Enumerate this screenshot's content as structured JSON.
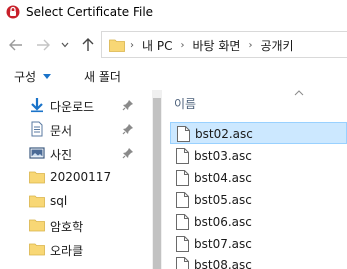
{
  "window": {
    "title": "Select Certificate File"
  },
  "address": {
    "crumbs": [
      "내 PC",
      "바탕 화면",
      "공개키"
    ]
  },
  "toolbar": {
    "organize": "구성",
    "new_folder": "새 폴더"
  },
  "sidebar": {
    "items": [
      {
        "label": "다운로드",
        "icon": "download-icon",
        "pinned": true
      },
      {
        "label": "문서",
        "icon": "documents-icon",
        "pinned": true
      },
      {
        "label": "사진",
        "icon": "pictures-icon",
        "pinned": true
      },
      {
        "label": "20200117",
        "icon": "folder-icon",
        "pinned": false
      },
      {
        "label": "sql",
        "icon": "folder-icon",
        "pinned": false
      },
      {
        "label": "암호학",
        "icon": "folder-icon",
        "pinned": false
      },
      {
        "label": "오라클",
        "icon": "folder-icon",
        "pinned": false
      }
    ]
  },
  "filelist": {
    "column_name": "이름",
    "files": [
      {
        "name": "bst02.asc",
        "selected": true
      },
      {
        "name": "bst03.asc",
        "selected": false
      },
      {
        "name": "bst04.asc",
        "selected": false
      },
      {
        "name": "bst05.asc",
        "selected": false
      },
      {
        "name": "bst06.asc",
        "selected": false
      },
      {
        "name": "bst07.asc",
        "selected": false
      },
      {
        "name": "bst08.asc",
        "selected": false
      }
    ]
  },
  "colors": {
    "selection_bg": "#cce8ff",
    "selection_border": "#99d1ff",
    "folder": "#f8d775",
    "accent_blue": "#1a73c9",
    "header_text": "#4c607a"
  }
}
